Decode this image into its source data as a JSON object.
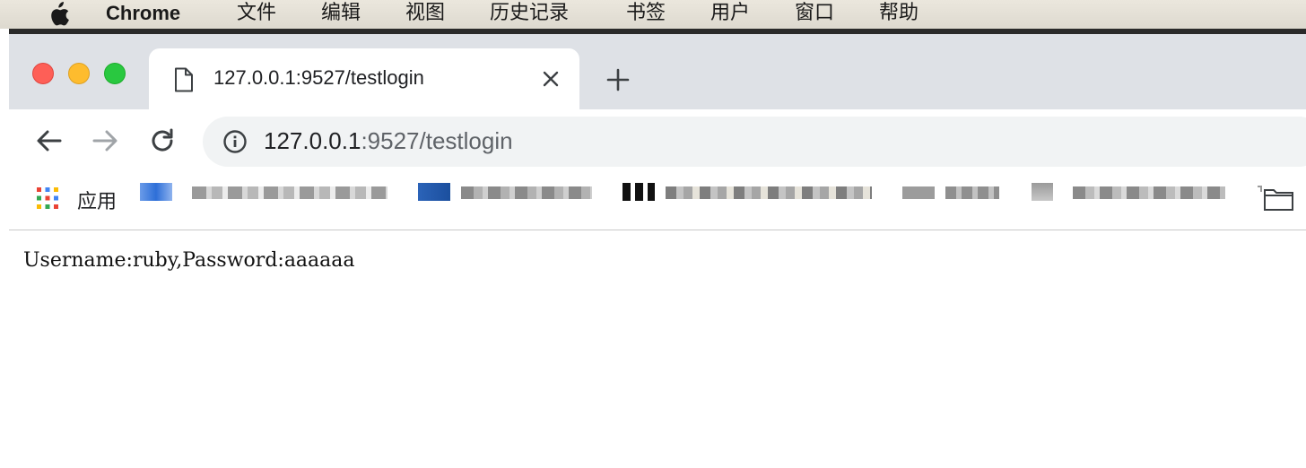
{
  "menubar": {
    "app_name": "Chrome",
    "items": [
      "文件",
      "编辑",
      "视图",
      "历史记录",
      "书签",
      "用户",
      "窗口",
      "帮助"
    ]
  },
  "tab": {
    "title": "127.0.0.1:9527/testlogin",
    "icon": "page-icon"
  },
  "toolbar": {
    "url_host": "127.0.0.1",
    "url_rest": ":9527/testlogin"
  },
  "bookmarks": {
    "apps_label": "应用"
  },
  "page": {
    "text": "Username:ruby,Password:aaaaaa"
  },
  "colors": {
    "close": "#fe5f57",
    "minimize": "#febc2e",
    "zoom": "#29c840",
    "tabstrip": "#dee1e6",
    "omnibox": "#f1f3f4"
  }
}
